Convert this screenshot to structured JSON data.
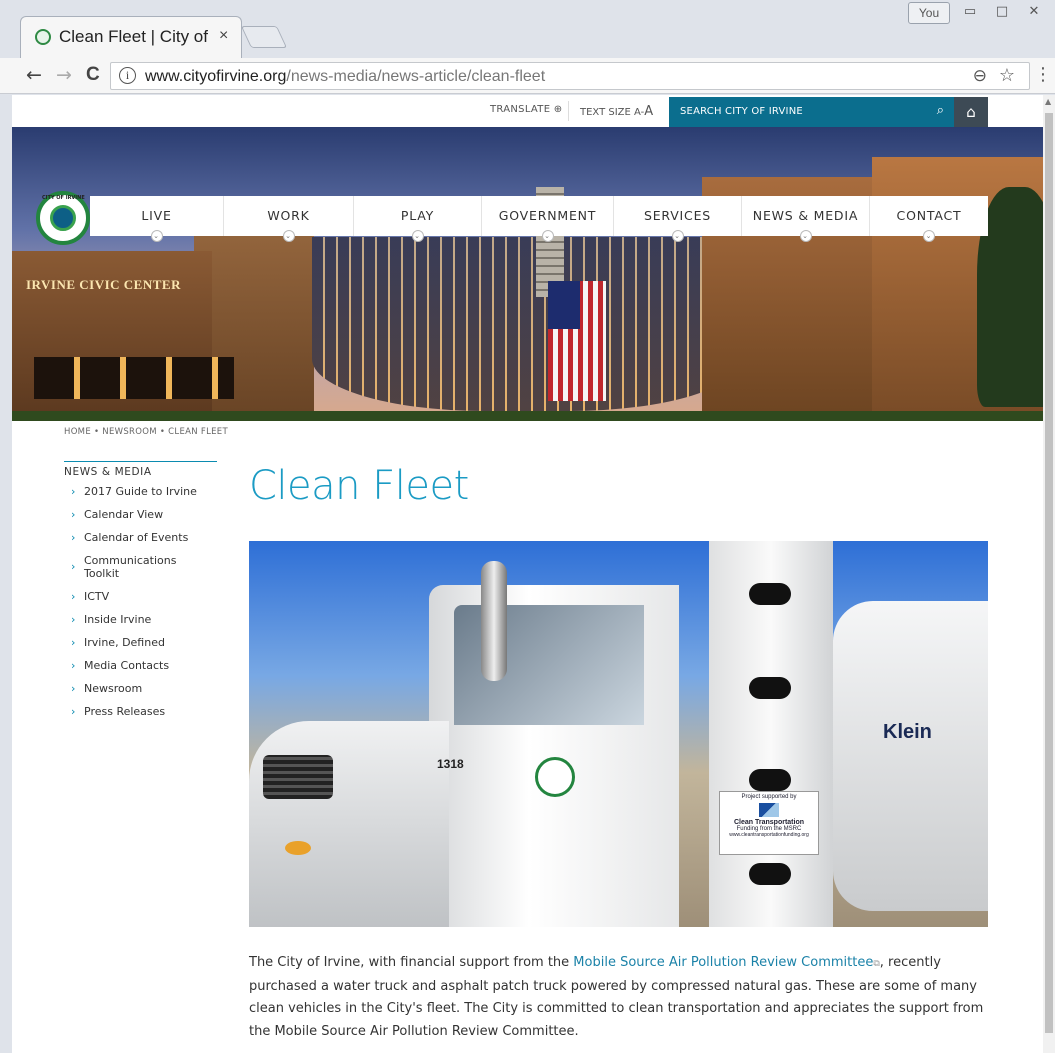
{
  "browser": {
    "tab_title": "Clean Fleet | City of Irvine",
    "tab_close": "×",
    "you_label": "You",
    "window_minimize": "▭",
    "window_restore": "□",
    "window_close": "✕",
    "url_domain": "www.cityofirvine.org",
    "url_path": "/news-media/news-article/clean-fleet",
    "back_icon": "←",
    "forward_icon": "→",
    "reload_icon": "C",
    "info_icon": "i",
    "zoom_icon": "⊖",
    "star_icon": "☆",
    "menu_icon": "⋮"
  },
  "utility": {
    "translate": "TRANSLATE ⊕",
    "text_size_label": "TEXT SIZE",
    "text_size_small": "A",
    "text_size_sep": "-",
    "text_size_big": "A",
    "search_placeholder": "SEARCH CITY OF IRVINE",
    "search_icon": "⌕",
    "home_icon": "⌂"
  },
  "hero": {
    "building_sign": "IRVINE CIVIC CENTER",
    "logo_text": "CITY OF IRVINE"
  },
  "nav": {
    "items": [
      {
        "label": "LIVE"
      },
      {
        "label": "WORK"
      },
      {
        "label": "PLAY"
      },
      {
        "label": "GOVERNMENT"
      },
      {
        "label": "SERVICES"
      },
      {
        "label": "NEWS & MEDIA"
      },
      {
        "label": "CONTACT"
      }
    ],
    "chevron": "⌄"
  },
  "breadcrumb": "HOME • NEWSROOM • CLEAN FLEET",
  "sidebar": {
    "title": "NEWS & MEDIA",
    "chevron": "›",
    "items": [
      {
        "label": "2017 Guide to Irvine"
      },
      {
        "label": "Calendar View"
      },
      {
        "label": "Calendar of Events"
      },
      {
        "label": "Communications Toolkit"
      },
      {
        "label": "ICTV"
      },
      {
        "label": "Inside Irvine"
      },
      {
        "label": "Irvine, Defined"
      },
      {
        "label": "Media Contacts"
      },
      {
        "label": "Newsroom"
      },
      {
        "label": "Press Releases"
      }
    ]
  },
  "article": {
    "title": "Clean Fleet",
    "photo": {
      "unit_number": "1318",
      "brand": "Klein",
      "sign_line1": "Project supported by",
      "sign_title": "Clean Transportation",
      "sign_line2": "Funding from the MSRC",
      "sign_url": "www.cleantransportationfunding.org"
    },
    "para_before_link": "The City of Irvine, with financial support from the ",
    "link_text": "Mobile Source Air Pollution Review Committee",
    "external_icon": "⧉",
    "para_after_link": ", recently purchased a water truck and asphalt patch truck powered by compressed natural gas. These are some of many clean vehicles in the City's fleet. The City is committed to clean transportation and appreciates the support from the Mobile Source Air Pollution Review Committee."
  },
  "colors": {
    "accent": "#1b9bc4",
    "search_bar": "#0b6e8e",
    "link": "#1b82a8",
    "logo_green": "#23853f"
  }
}
